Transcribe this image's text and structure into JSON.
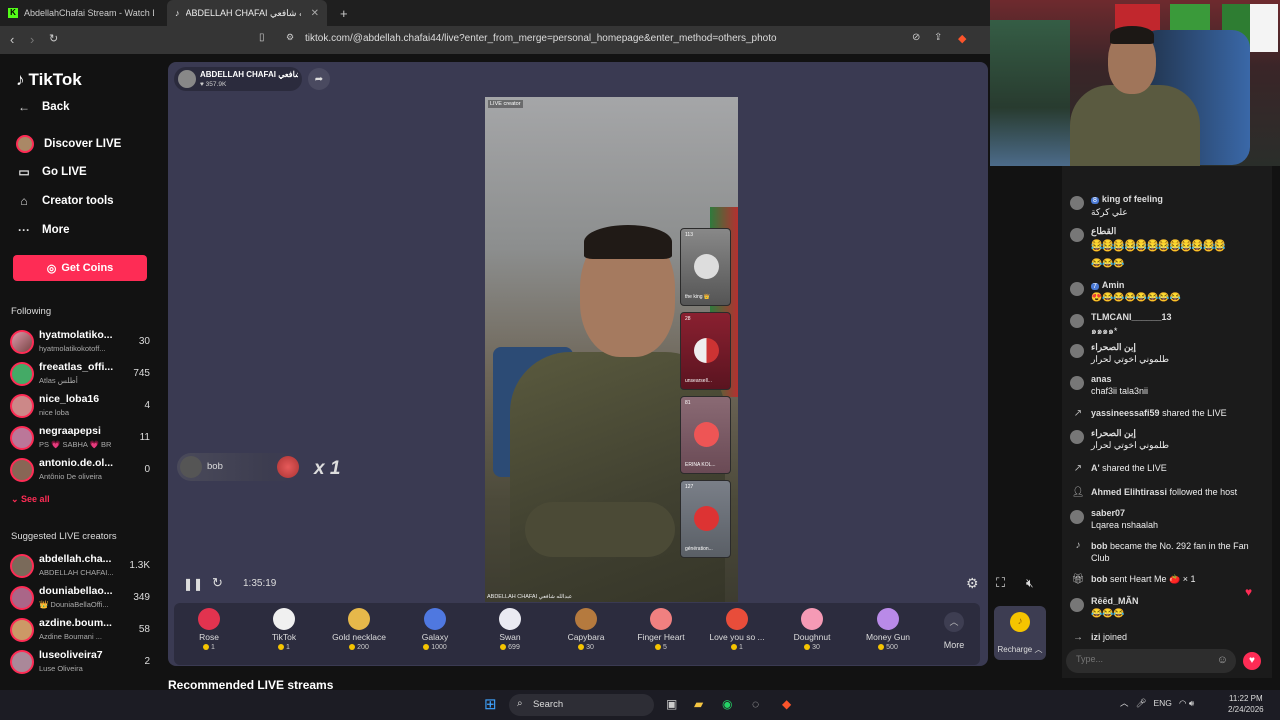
{
  "browser": {
    "tabs": [
      {
        "label": "AbdellahChafai Stream - Watch Live"
      },
      {
        "label": "ABDELLAH CHAFAI عبدالله شافعي"
      }
    ],
    "url": "tiktok.com/@abdellah.chafai44/live?enter_from_merge=personal_homepage&enter_method=others_photo"
  },
  "sidebar": {
    "logo": "TikTok",
    "back": "Back",
    "nav": [
      "Discover LIVE",
      "Go LIVE",
      "Creator tools",
      "More"
    ],
    "get_coins": "Get Coins",
    "following_title": "Following",
    "following": [
      {
        "name": "hyatmolatiko...",
        "sub": "hyatmolatikokotoff...",
        "count": "30"
      },
      {
        "name": "freeatlas_offi...",
        "sub": "Atlas أطلس",
        "count": "745"
      },
      {
        "name": "nice_loba16",
        "sub": "nice loba",
        "count": "4"
      },
      {
        "name": "negraapepsi",
        "sub": "PS 💗 SABHA 💗 BR",
        "count": "11"
      },
      {
        "name": "antonio.de.ol...",
        "sub": "Antônio De oliveira",
        "count": "0"
      }
    ],
    "see_all": "See all",
    "suggested_title": "Suggested LIVE creators",
    "suggested": [
      {
        "name": "abdellah.cha...",
        "sub": "ABDELLAH CHAFAI...",
        "count": "1.3K"
      },
      {
        "name": "douniabellao...",
        "sub": "👑 DouniaBellaOffi...",
        "count": "349"
      },
      {
        "name": "azdine.boum...",
        "sub": "Azdine Boumani ...",
        "count": "58"
      },
      {
        "name": "luseoliveira7",
        "sub": "Luse Oliveira",
        "count": "2"
      }
    ]
  },
  "stream": {
    "host_name": "ABDELLAH CHAFAI عبدالله شافعي",
    "host_likes": "357.9K",
    "video_tag": "LIVE creator",
    "video_watermark": "ABDELLAH CHAFAI عبدالله شافعي",
    "guests": [
      {
        "num": "113",
        "name": "the king 👑"
      },
      {
        "num": "28",
        "name": "unsearsell..."
      },
      {
        "num": "81",
        "name": "ERINA KOL..."
      },
      {
        "num": "127",
        "name": "génération..."
      }
    ],
    "gift_user": "bob",
    "gift_combo": "x 1",
    "elapsed": "1:35:19"
  },
  "gifts": [
    {
      "name": "Rose",
      "price": "1",
      "color": "#e2334f"
    },
    {
      "name": "TikTok",
      "price": "1",
      "color": "#f0f0f0"
    },
    {
      "name": "Gold necklace",
      "price": "200",
      "color": "#e6b84a"
    },
    {
      "name": "Galaxy",
      "price": "1000",
      "color": "#4f78e0"
    },
    {
      "name": "Swan",
      "price": "699",
      "color": "#eaeaf2"
    },
    {
      "name": "Capybara",
      "price": "30",
      "color": "#b57a3e"
    },
    {
      "name": "Finger Heart",
      "price": "5",
      "color": "#f08080"
    },
    {
      "name": "Love you so ...",
      "price": "1",
      "color": "#e84d3a"
    },
    {
      "name": "Doughnut",
      "price": "30",
      "color": "#f59ab5"
    },
    {
      "name": "Money Gun",
      "price": "500",
      "color": "#b98ae8"
    }
  ],
  "more_label": "More",
  "recharge_label": "Recharge",
  "recommended": "Recommended LIVE streams",
  "chat": {
    "messages": [
      {
        "badge": "8",
        "user": "king of feeling",
        "text": "علي كركة"
      },
      {
        "badge": "",
        "user": "القطاع",
        "text": "😂😂😂😂😂😂😂😂😂😂😂😂"
      },
      {
        "badge": "",
        "user": "",
        "text": "😂😂😂😂😂😂😂😂😂😂😂😂"
      },
      {
        "badge": "",
        "user": "",
        "text": "😂😂😂"
      },
      {
        "badge": "7",
        "user": "Amin",
        "text": "😍😂😂😂😂😂😂😂"
      },
      {
        "badge": "",
        "user": "TLMCANI______13",
        "text": "๑๑๑๑*"
      },
      {
        "badge": "",
        "user": "إبن الصحراء",
        "text": "طلموني اخوتي لحرار"
      },
      {
        "badge": "",
        "user": "anas",
        "text": "chaf3ii tala3nii"
      },
      {
        "badge": "",
        "user": "yassineessafi59",
        "text": "shared the LIVE"
      },
      {
        "badge": "",
        "user": "إبن الصحراء",
        "text": "طلموني اخوتي لحرار"
      },
      {
        "badge": "",
        "user": "A'",
        "text": "shared the LIVE"
      },
      {
        "badge": "",
        "user": "Ahmed Elihtirassi",
        "text": "followed the host"
      },
      {
        "badge": "",
        "user": "saber07",
        "text": "Lqarea nshaalah"
      },
      {
        "badge": "",
        "user": "bob",
        "text": "became the No. 292 fan in the Fan Club"
      },
      {
        "badge": "",
        "user": "bob",
        "text": "sent Heart Me 🍅 × 1"
      },
      {
        "badge": "",
        "user": "Rēēd_MÃN",
        "text": "😂😂😂"
      },
      {
        "badge": "",
        "user": "izi",
        "text": "joined"
      }
    ],
    "placeholder": "Type..."
  },
  "taskbar": {
    "search": "Search",
    "lang": "ENG",
    "time": "11:22 PM",
    "date": "2/24/2026"
  }
}
